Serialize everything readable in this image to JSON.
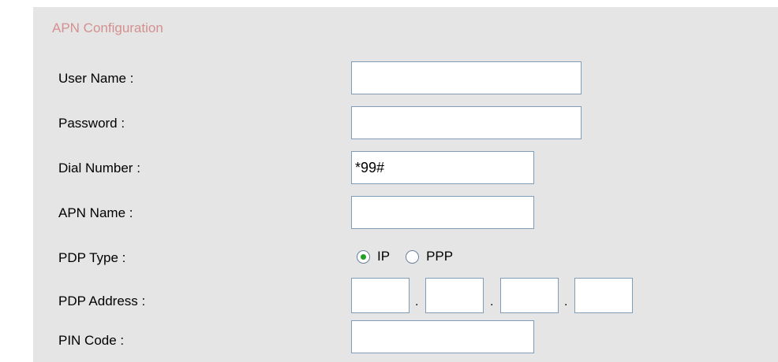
{
  "section": {
    "title": "APN Configuration"
  },
  "fields": {
    "user_name": {
      "label": "User Name :",
      "value": ""
    },
    "password": {
      "label": "Password :",
      "value": ""
    },
    "dial_number": {
      "label": "Dial Number :",
      "value": "*99#"
    },
    "apn_name": {
      "label": "APN Name :",
      "value": ""
    },
    "pdp_type": {
      "label": "PDP Type :",
      "options": [
        "IP",
        "PPP"
      ],
      "selected": "IP"
    },
    "pdp_address": {
      "label": "PDP Address :",
      "octets": [
        "",
        "",
        "",
        ""
      ],
      "separator": "."
    },
    "pin_code": {
      "label": "PIN Code :",
      "value": ""
    }
  },
  "colors": {
    "panel_bg": "#e5e5e5",
    "title": "#d49090",
    "input_border": "#7f9db9",
    "radio_dot": "#21a121"
  }
}
